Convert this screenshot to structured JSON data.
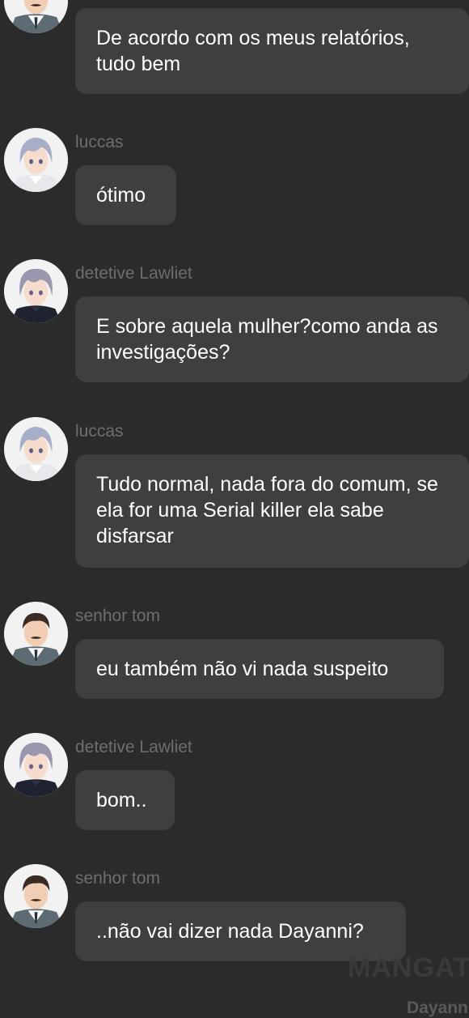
{
  "messages": [
    {
      "author": "",
      "avatar": "tom-avatar-icon",
      "text": "De acordo com os meus relatórios, tudo bem"
    },
    {
      "author": "luccas",
      "avatar": "luccas-avatar-icon",
      "text": "ótimo"
    },
    {
      "author": "detetive Lawliet",
      "avatar": "lawliet-avatar-icon",
      "text": "E sobre aquela mulher?como anda as investigações?"
    },
    {
      "author": "luccas",
      "avatar": "luccas-avatar-icon",
      "text": "Tudo normal, nada fora do comum, se ela for uma Serial killer ela sabe disfarsar"
    },
    {
      "author": "senhor tom",
      "avatar": "tom-avatar-icon",
      "text": "eu também não vi nada suspeito"
    },
    {
      "author": "detetive Lawliet",
      "avatar": "lawliet-avatar-icon",
      "text": "bom.."
    },
    {
      "author": "senhor tom",
      "avatar": "tom-avatar-icon",
      "text": "..não vai dizer nada Dayanni?"
    }
  ],
  "watermark": "MANGAT",
  "credit": "Dayanni",
  "colors": {
    "background": "#2b2b2b",
    "bubble": "#3f3f3f",
    "author": "#6e6e6e",
    "text": "#ffffff"
  }
}
